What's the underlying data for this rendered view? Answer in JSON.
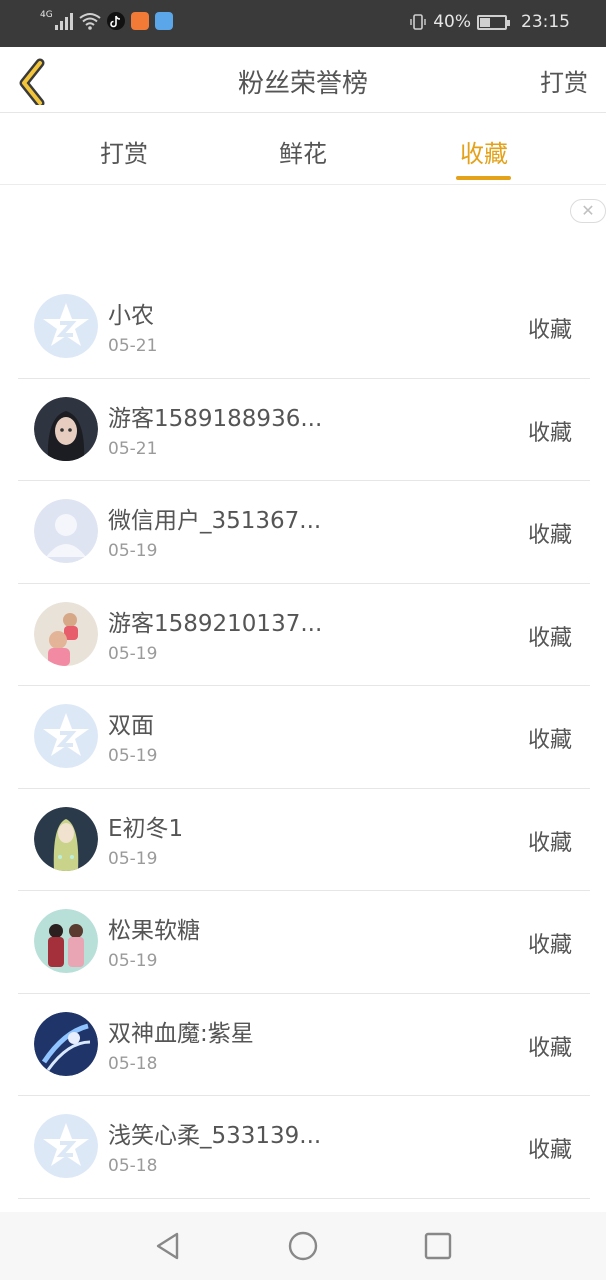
{
  "status_bar": {
    "network_label": "4G",
    "battery": "40%",
    "battery_level": 0.4,
    "time": "23:15"
  },
  "header": {
    "title": "粉丝荣誉榜",
    "action_label": "打赏"
  },
  "tabs": [
    {
      "label": "打赏",
      "active": false
    },
    {
      "label": "鲜花",
      "active": false
    },
    {
      "label": "收藏",
      "active": true
    }
  ],
  "close_label": "✕",
  "list": [
    {
      "name": "小农",
      "date": "05-21",
      "action": "收藏",
      "avatar": "default-star"
    },
    {
      "name": "游客1589188936...",
      "date": "05-21",
      "action": "收藏",
      "avatar": "photo-dark-girl"
    },
    {
      "name": "微信用户_351367...",
      "date": "05-19",
      "action": "收藏",
      "avatar": "default-person"
    },
    {
      "name": "游客1589210137...",
      "date": "05-19",
      "action": "收藏",
      "avatar": "photo-children"
    },
    {
      "name": "双面",
      "date": "05-19",
      "action": "收藏",
      "avatar": "default-star"
    },
    {
      "name": "E初冬1",
      "date": "05-19",
      "action": "收藏",
      "avatar": "photo-anime-girl"
    },
    {
      "name": "松果软糖",
      "date": "05-19",
      "action": "收藏",
      "avatar": "photo-couple"
    },
    {
      "name": "双神血魔:紫星",
      "date": "05-18",
      "action": "收藏",
      "avatar": "photo-blue-fantasy"
    },
    {
      "name": "浅笑心柔_533139...",
      "date": "05-18",
      "action": "收藏",
      "avatar": "default-star"
    }
  ],
  "colors": {
    "accent": "#e3a21a",
    "status_bar": "#3a3a3a"
  }
}
